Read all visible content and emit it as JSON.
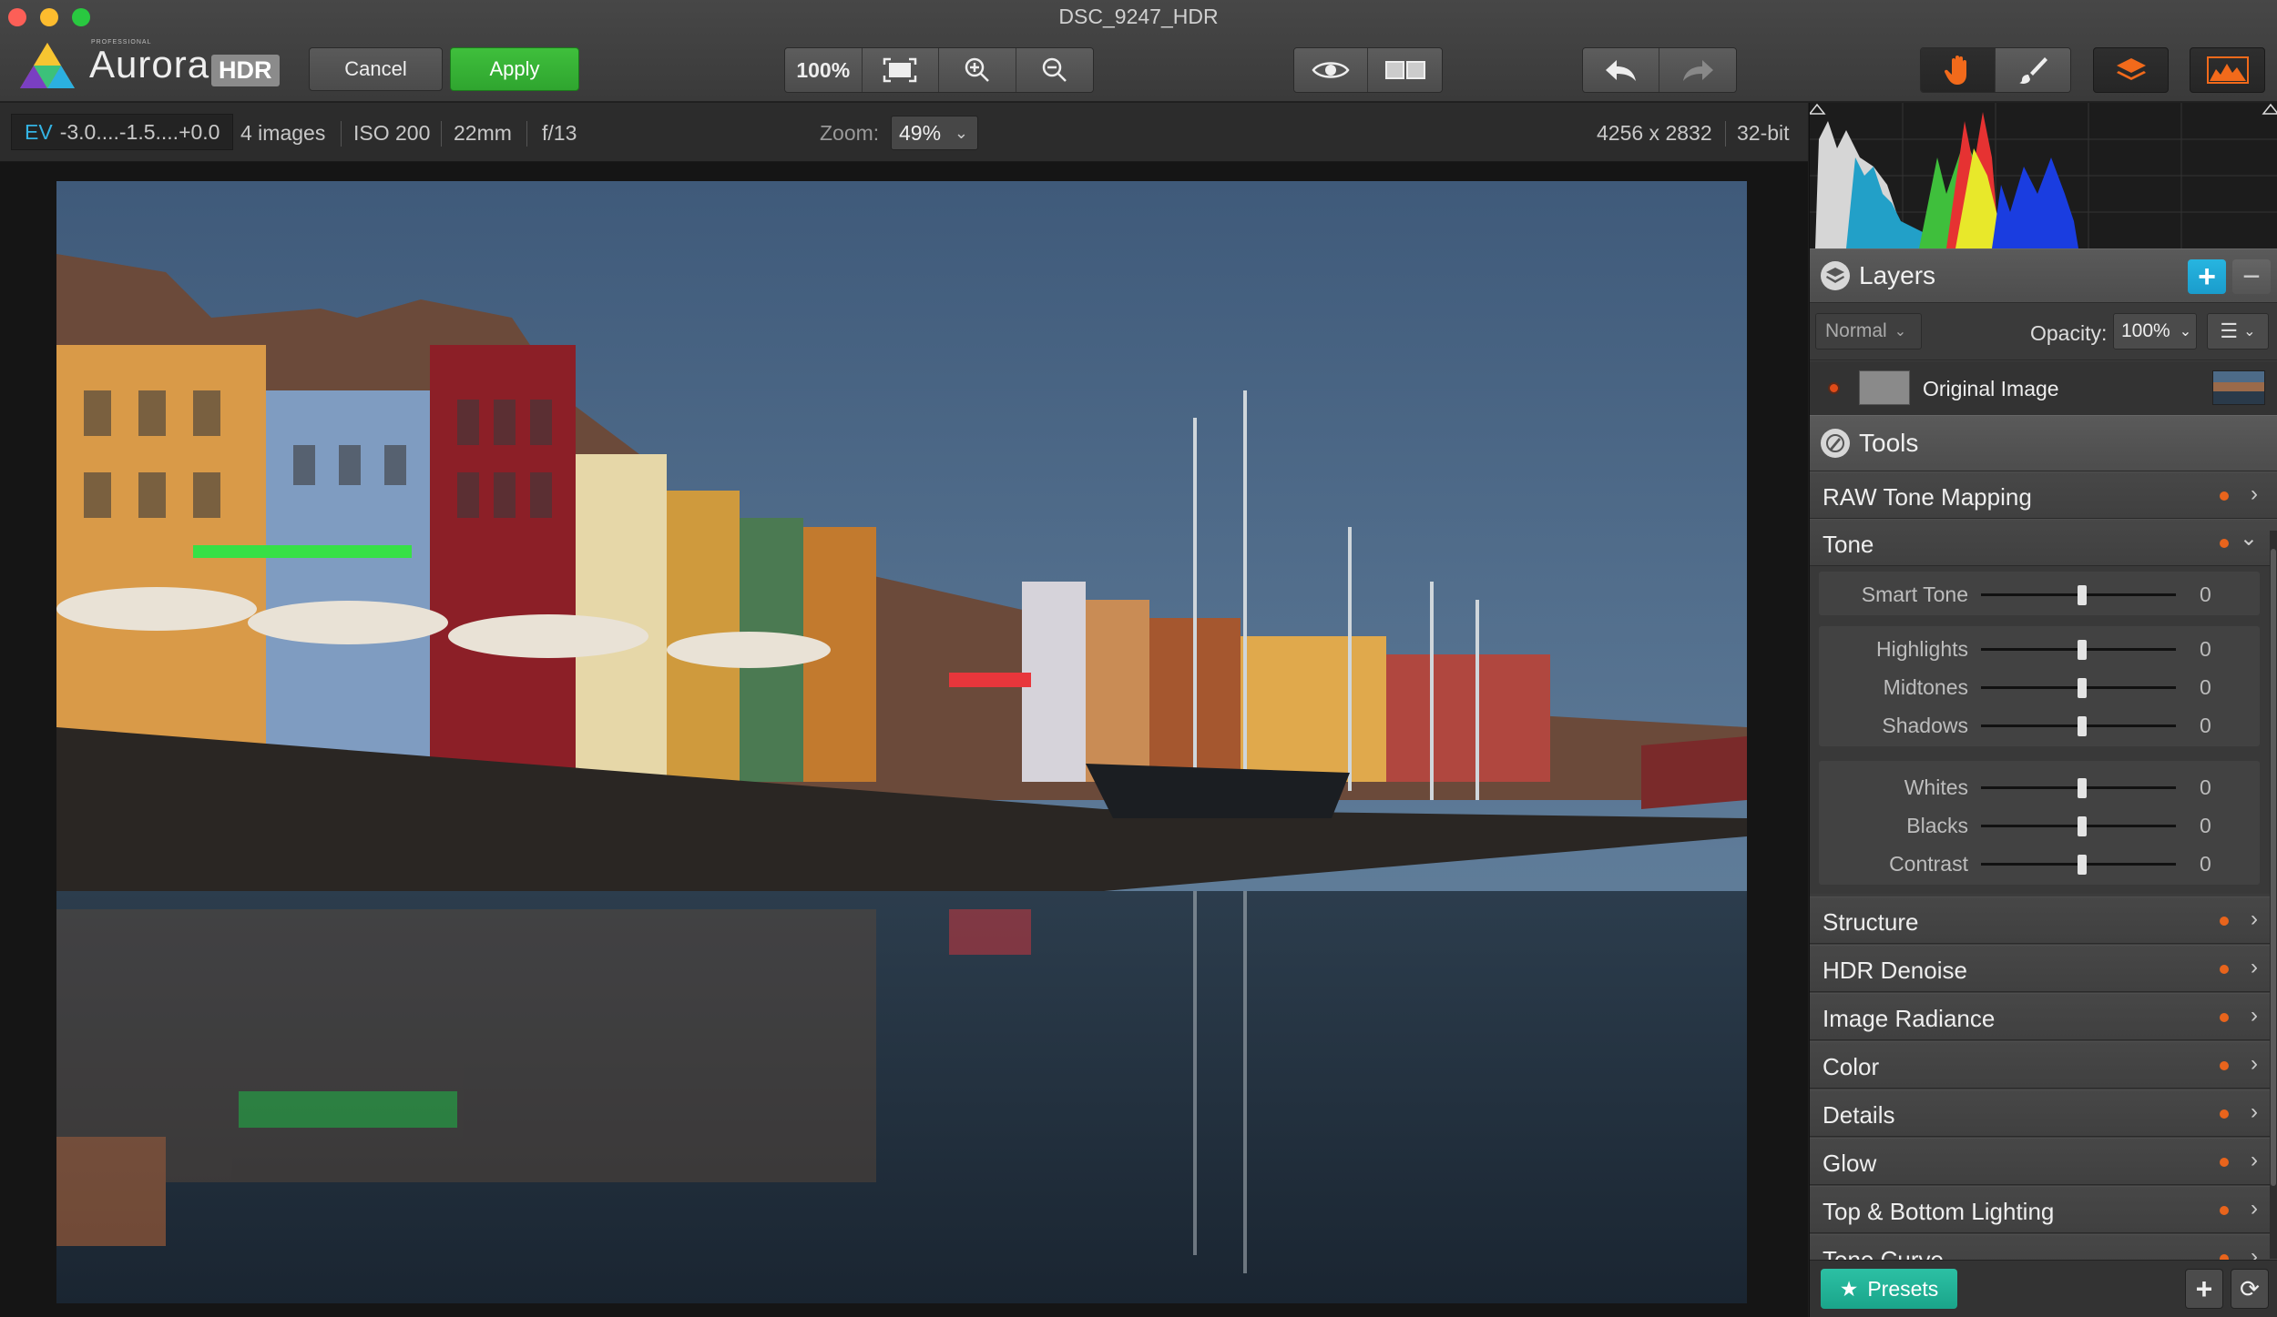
{
  "window": {
    "title": "DSC_9247_HDR"
  },
  "app": {
    "name": "Aurora",
    "edition": "PROFESSIONAL",
    "badge": "HDR"
  },
  "toolbar": {
    "cancel_label": "Cancel",
    "apply_label": "Apply",
    "zoom_100_label": "100%",
    "icons": [
      "fit-screen-icon",
      "zoom-in-icon",
      "zoom-out-icon",
      "eye-icon",
      "compare-icon",
      "undo-icon",
      "redo-icon",
      "hand-icon",
      "brush-icon",
      "layers-icon",
      "histogram-icon"
    ]
  },
  "info": {
    "ev_label": "EV",
    "ev_value": "-3.0....-1.5....+0.0",
    "images": "4 images",
    "iso": "ISO 200",
    "focal": "22mm",
    "aperture": "f/13",
    "zoom_label": "Zoom:",
    "zoom_value": "49%",
    "dimensions": "4256 x 2832",
    "bit_depth": "32-bit"
  },
  "layers": {
    "title": "Layers",
    "blend_mode": "Normal",
    "opacity_label": "Opacity:",
    "opacity_value": "100%",
    "items": [
      {
        "name": "Original Image"
      }
    ]
  },
  "tools": {
    "title": "Tools",
    "items": [
      {
        "label": "RAW Tone Mapping",
        "expanded": false
      },
      {
        "label": "Tone",
        "expanded": true
      },
      {
        "label": "Structure",
        "expanded": false
      },
      {
        "label": "HDR Denoise",
        "expanded": false
      },
      {
        "label": "Image Radiance",
        "expanded": false
      },
      {
        "label": "Color",
        "expanded": false
      },
      {
        "label": "Details",
        "expanded": false
      },
      {
        "label": "Glow",
        "expanded": false
      },
      {
        "label": "Top & Bottom Lighting",
        "expanded": false
      },
      {
        "label": "Tone Curve",
        "expanded": false
      }
    ],
    "tone_sliders": [
      {
        "label": "Smart Tone",
        "value": "0"
      },
      {
        "label": "Highlights",
        "value": "0"
      },
      {
        "label": "Midtones",
        "value": "0"
      },
      {
        "label": "Shadows",
        "value": "0"
      },
      {
        "label": "Whites",
        "value": "0"
      },
      {
        "label": "Blacks",
        "value": "0"
      },
      {
        "label": "Contrast",
        "value": "0"
      }
    ]
  },
  "bottom": {
    "presets_label": "Presets"
  },
  "colors": {
    "accent_blue": "#1a9ccc",
    "apply_green": "#2fa52f",
    "presets_teal": "#1aa58a",
    "indicator_orange": "#e8641c"
  }
}
